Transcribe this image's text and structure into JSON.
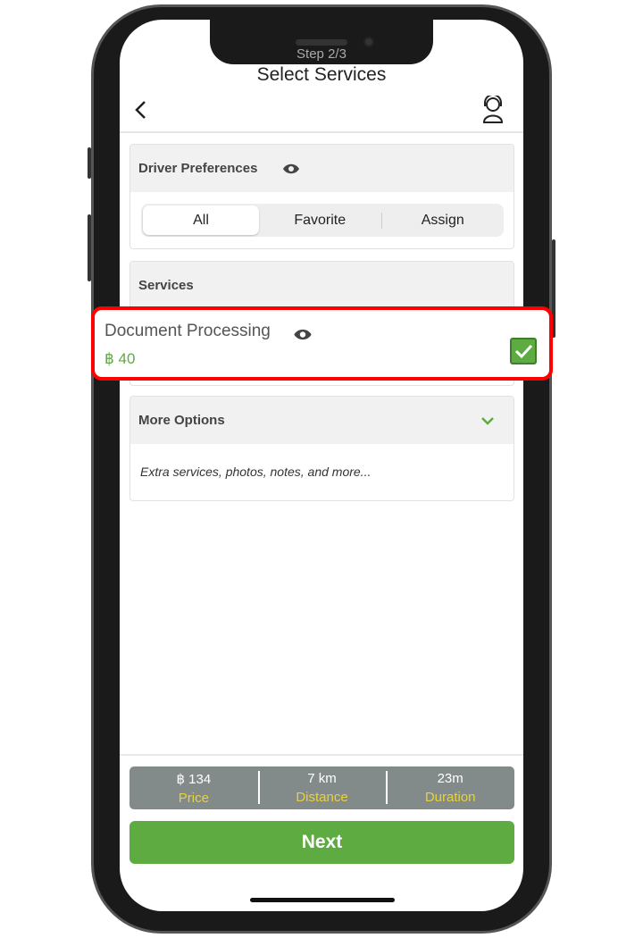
{
  "header": {
    "step": "Step 2/3",
    "title": "Select Services"
  },
  "driver_preferences": {
    "title": "Driver Preferences",
    "tabs": [
      {
        "label": "All",
        "selected": true
      },
      {
        "label": "Favorite",
        "selected": false
      },
      {
        "label": "Assign",
        "selected": false
      }
    ]
  },
  "services": {
    "title": "Services",
    "items": [
      {
        "name": "Document Processing",
        "price": "฿ 40",
        "checked": true
      }
    ]
  },
  "more_options": {
    "title": "More Options",
    "description": "Extra services, photos, notes, and more..."
  },
  "summary": {
    "price_value": "฿ 134",
    "price_label": "Price",
    "distance_value": "7 km",
    "distance_label": "Distance",
    "duration_value": "23m",
    "duration_label": "Duration"
  },
  "next_label": "Next",
  "colors": {
    "accent": "#5eab42",
    "highlight": "#ff0000",
    "label_yellow": "#e8d23b"
  }
}
